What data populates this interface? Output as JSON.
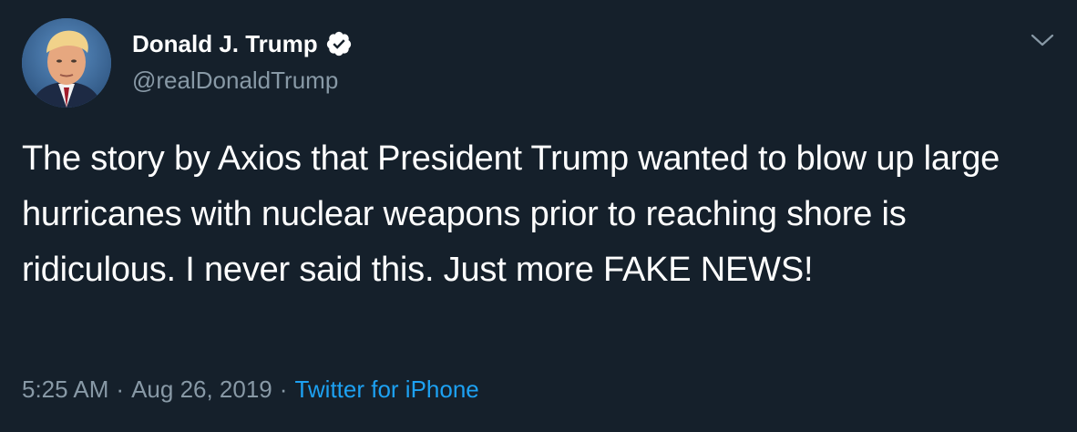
{
  "author": {
    "display_name": "Donald J. Trump",
    "handle": "@realDonaldTrump",
    "verified": true,
    "avatar_icon": "avatar-photo"
  },
  "tweet": {
    "text": "The story by Axios that President Trump wanted to blow up large hurricanes with nuclear weapons prior to reaching shore is ridiculous. I never said this. Just more FAKE NEWS!",
    "time": "5:25 AM",
    "separator": "·",
    "date": "Aug 26, 2019",
    "source": "Twitter for iPhone"
  },
  "icons": {
    "verified": "verified-badge-icon",
    "menu": "chevron-down-icon"
  },
  "colors": {
    "background": "#15202b",
    "primary_text": "#ffffff",
    "secondary_text": "#8899a6",
    "link": "#1da1f2"
  }
}
